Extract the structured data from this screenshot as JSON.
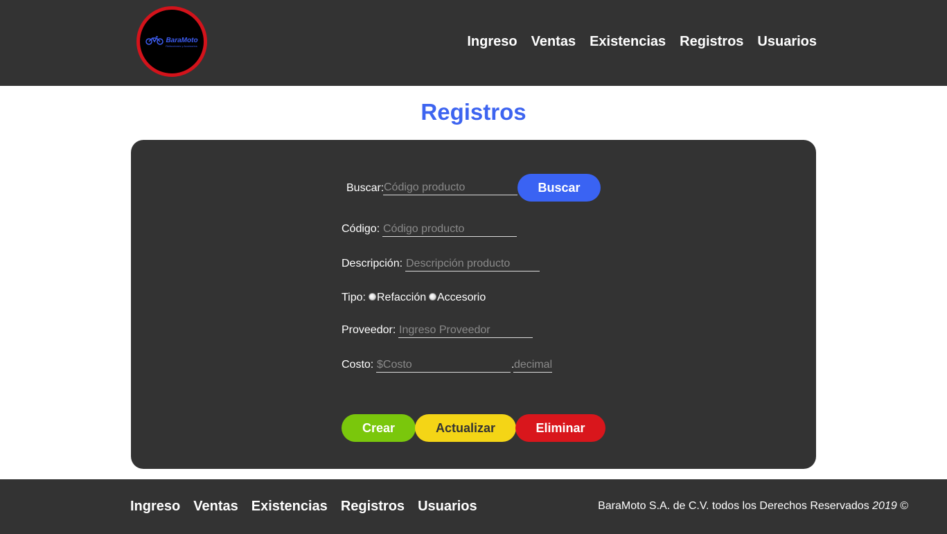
{
  "header": {
    "logo": {
      "brand": "BaraMoto",
      "tagline": "Refacciones y Accesorios",
      "icon": "motorcycle-icon",
      "border_color": "#d3131b",
      "text_color": "#3d5df2"
    },
    "nav": [
      "Ingreso",
      "Ventas",
      "Existencias",
      "Registros",
      "Usuarios"
    ]
  },
  "page": {
    "title": "Registros",
    "title_color": "#3d64f0"
  },
  "form": {
    "search": {
      "label": "Buscar:",
      "placeholder": "Código producto",
      "value": "",
      "button_label": "Buscar",
      "button_color": "#3a63f3"
    },
    "code": {
      "label": "Código:",
      "placeholder": "Código producto",
      "value": ""
    },
    "description": {
      "label": "Descripción:",
      "placeholder": "Descripción producto",
      "value": ""
    },
    "type": {
      "label": "Tipo:",
      "options": [
        "Refacción",
        "Accesorio"
      ],
      "selected": null
    },
    "supplier": {
      "label": "Proveedor:",
      "placeholder": "Ingreso Proveedor",
      "value": ""
    },
    "cost": {
      "label": "Costo:",
      "placeholder": "$Costo",
      "decimal_separator": ".",
      "decimal_placeholder": "decimal",
      "value": ""
    },
    "actions": {
      "create": {
        "label": "Crear",
        "color": "#7ac70c"
      },
      "update": {
        "label": "Actualizar",
        "color": "#f4d516"
      },
      "delete": {
        "label": "Eliminar",
        "color": "#d9161c"
      }
    }
  },
  "footer": {
    "nav": [
      "Ingreso",
      "Ventas",
      "Existencias",
      "Registros",
      "Usuarios"
    ],
    "copyright_text": "BaraMoto S.A. de C.V. todos los Derechos Reservados",
    "copyright_year": "2019",
    "copyright_symbol": "©"
  }
}
